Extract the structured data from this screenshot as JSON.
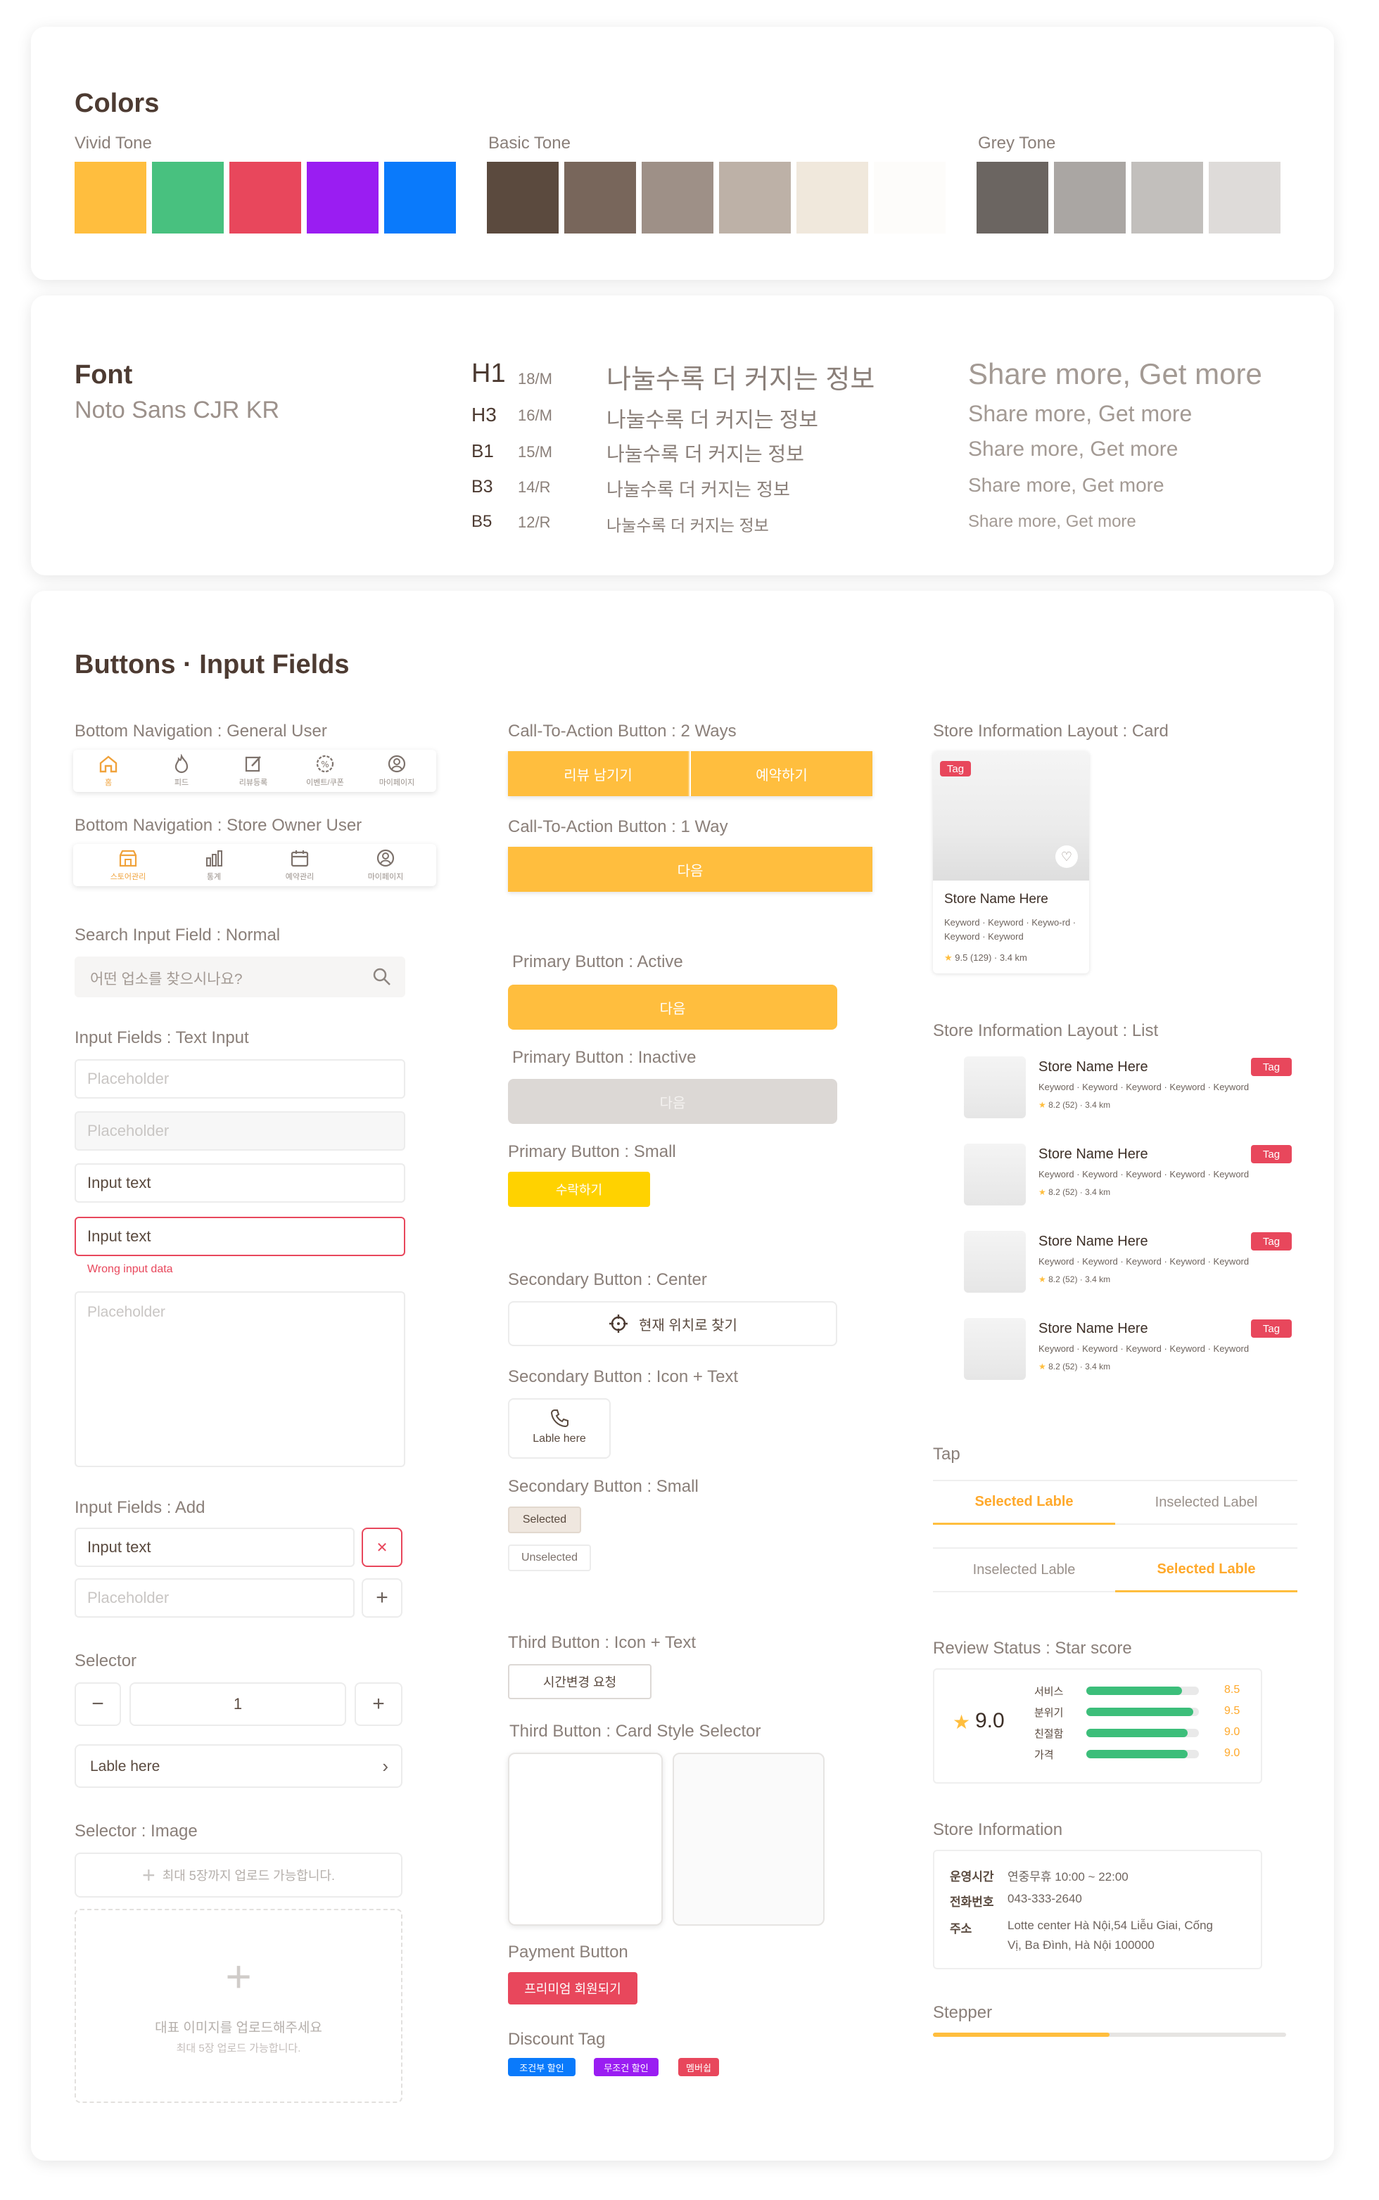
{
  "colors": {
    "title": "Colors",
    "vivid_label": "Vivid Tone",
    "basic_label": "Basic Tone",
    "grey_label": "Grey Tone",
    "vivid": [
      "#ffbe3e",
      "#48c17f",
      "#e8475c",
      "#9a1df2",
      "#0a7afb"
    ],
    "basic": [
      "#5b4a3e",
      "#78665b",
      "#9e9087",
      "#bdb1a7",
      "#f0e8dc",
      "#fdfcfa"
    ],
    "grey": [
      "#6b6561",
      "#aaa6a3",
      "#c2bfbc",
      "#dedbd9"
    ]
  },
  "font": {
    "title": "Font",
    "family": "Noto Sans CJR KR",
    "rows": [
      {
        "code": "H1",
        "spec": "18/M",
        "ko": "나눌수록 더 커지는 정보",
        "en": "Share more, Get more"
      },
      {
        "code": "H3",
        "spec": "16/M",
        "ko": "나눌수록 더 커지는 정보",
        "en": "Share more, Get more"
      },
      {
        "code": "B1",
        "spec": "15/M",
        "ko": "나눌수록 더 커지는 정보",
        "en": "Share more, Get more"
      },
      {
        "code": "B3",
        "spec": "14/R",
        "ko": "나눌수록 더 커지는 정보",
        "en": "Share more, Get more"
      },
      {
        "code": "B5",
        "spec": "12/R",
        "ko": "나눌수록 더 커지는 정보",
        "en": "Share more, Get more"
      }
    ]
  },
  "buttons_title": "Buttons · Input Fields",
  "left": {
    "nav_general_label": "Bottom Navigation : General User",
    "nav_general": [
      "홈",
      "피드",
      "리뷰등록",
      "이벤트/쿠폰",
      "마이페이지"
    ],
    "nav_owner_label": "Bottom Navigation : Store Owner User",
    "nav_owner": [
      "스토어관리",
      "통계",
      "예약관리",
      "마이페이지"
    ],
    "search_label": "Search Input Field : Normal",
    "search_placeholder": "어떤 업소를 찾으시나요?",
    "text_input_label": "Input Fields  : Text Input",
    "placeholder": "Placeholder",
    "input_text": "Input text",
    "wrong": "Wrong input data",
    "add_label": "Input Fields  : Add",
    "selector_label": "Selector",
    "selector_value": "1",
    "selector_row": "Lable here",
    "image_label": "Selector : Image",
    "image_small": "최대 5장까지 업로드 가능합니다.",
    "image_main": "대표 이미지를 업로드해주세요",
    "image_sub": "최대 5장 업로드 가능합니다."
  },
  "mid": {
    "cta2_label": "Call-To-Action Button : 2 Ways",
    "cta2_left": "리뷰 남기기",
    "cta2_right": "예약하기",
    "cta1_label": "Call-To-Action Button : 1 Way",
    "cta1": "다음",
    "prim_active_label": "Primary Button : Active",
    "prim_active": "다음",
    "prim_inactive_label": "Primary Button : Inactive",
    "prim_inactive": "다음",
    "prim_small_label": "Primary Button : Small",
    "prim_small": "수락하기",
    "sec_center_label": "Secondary Button : Center",
    "sec_center": "현재 위치로 찾기",
    "sec_icon_label": "Secondary Button : Icon + Text",
    "sec_icon": "Lable here",
    "sec_small_label": "Secondary Button : Small",
    "selected": "Selected",
    "unselected": "Unselected",
    "third_label": "Third Button : Icon + Text",
    "third": "시간변경 요청",
    "third_card_label": "Third Button : Card Style Selector",
    "payment_label": "Payment Button",
    "payment": "프리미엄 회원되기",
    "discount_label": "Discount Tag",
    "discount": [
      "조건부 할인",
      "무조건 할인",
      "멤버쉽"
    ],
    "discount_colors": [
      "#0a7afb",
      "#9a1df2",
      "#e8475c"
    ]
  },
  "right": {
    "card_label": "Store Information Layout : Card",
    "tag": "Tag",
    "store_name": "Store Name Here",
    "card_keywords": "Keyword · Keyword · Keywo-rd · Keyword · Keyword",
    "card_rating": "9.5 (129) · 3.4 km",
    "list_label": "Store Information Layout : List",
    "list_keywords": "Keyword · Keyword · Keyword · Keyword · Keyword",
    "list_rating": "8.2 (52) · 3.4 km",
    "tap_label": "Tap",
    "tap1": [
      "Selected Lable",
      "Inselected Label"
    ],
    "tap2": [
      "Inselected Lable",
      "Selected Lable"
    ],
    "review_label": "Review Status : Star score",
    "review_score": "9.0",
    "review_rows": [
      {
        "name": "서비스",
        "score": "8.5",
        "value": 0.85
      },
      {
        "name": "분위기",
        "score": "9.5",
        "value": 0.95
      },
      {
        "name": "친절함",
        "score": "9.0",
        "value": 0.9
      },
      {
        "name": "가격",
        "score": "9.0",
        "value": 0.9
      }
    ],
    "info_label": "Store Information",
    "info_hours_key": "운영시간",
    "info_hours": "연중무휴 10:00 ~ 22:00",
    "info_phone_key": "전화번호",
    "info_phone": "043-333-2640",
    "info_addr_key": "주소",
    "info_addr1": "Lotte center Hà Nội,54 Liễu Giai, Cống",
    "info_addr2": "Vị, Ba Đình, Hà Nội  100000",
    "stepper_label": "Stepper",
    "stepper_progress": 0.5
  }
}
